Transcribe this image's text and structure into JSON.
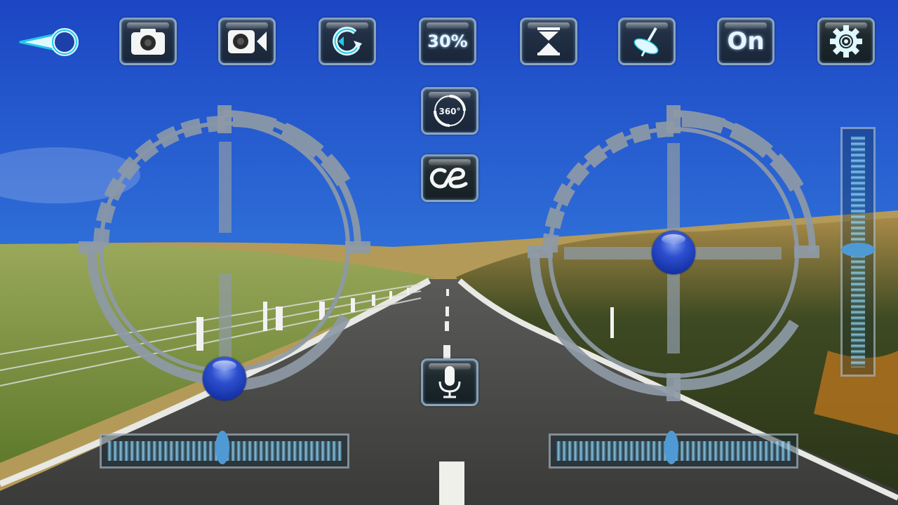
{
  "toolbar": {
    "back": {
      "icon": "back-arrow-icon"
    },
    "photo": {
      "icon": "camera-icon"
    },
    "video": {
      "icon": "video-camera-icon"
    },
    "flip_direction": {
      "icon": "rotate-icon"
    },
    "speed": {
      "label": "30%"
    },
    "altitude_hold": {
      "icon": "hourglass-icon"
    },
    "gyro_calibrate": {
      "icon": "gyro-calibrate-icon"
    },
    "power": {
      "label": "On"
    },
    "settings": {
      "icon": "gear-icon"
    }
  },
  "center_controls": {
    "flip_360": {
      "label": "360°",
      "icon": "flip-360-icon"
    },
    "headless": {
      "icon": "headless-mode-icon"
    },
    "voice": {
      "icon": "microphone-icon"
    }
  },
  "left_joystick": {
    "name": "throttle-yaw",
    "x": 0.0,
    "y": -1.0
  },
  "right_joystick": {
    "name": "pitch-roll",
    "x": 0.0,
    "y": 0.0
  },
  "trims": {
    "left_horizontal": 0.49,
    "right_horizontal": 0.49,
    "right_vertical": 0.51
  },
  "colors": {
    "accent": "#4f9ad4",
    "joystick_ball": "#2d4fcf",
    "button_border": "#aac8e6",
    "icon_glow": "#22c8e8"
  }
}
